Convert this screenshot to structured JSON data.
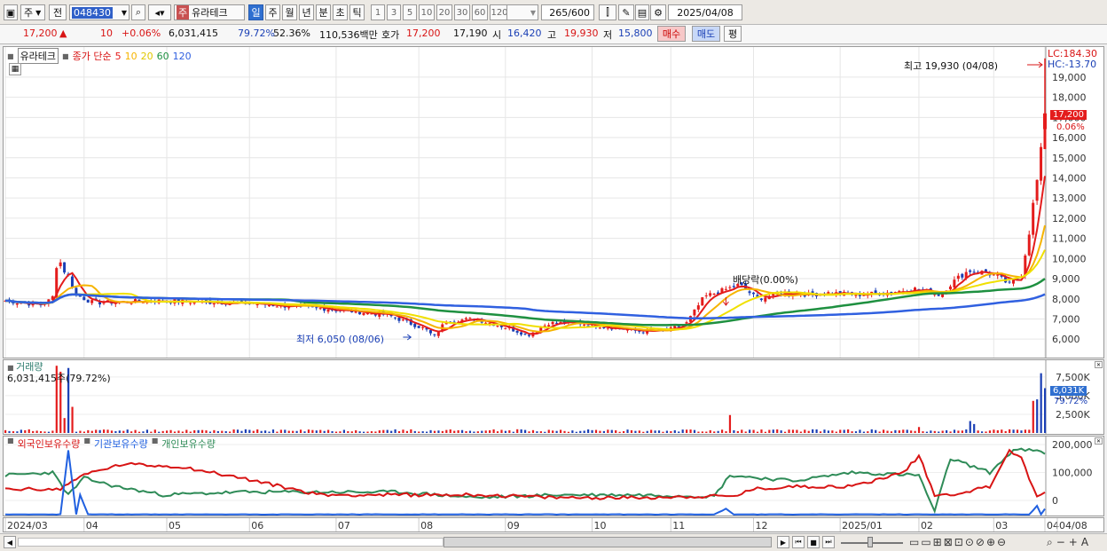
{
  "toolbar": {
    "market": "주",
    "prev": "전",
    "code": "048430",
    "name_tag": "주",
    "name": "유라테크",
    "periods": [
      "일",
      "주",
      "월",
      "년",
      "분",
      "초",
      "틱"
    ],
    "intervals": [
      "1",
      "3",
      "5",
      "10",
      "20",
      "30",
      "60",
      "120"
    ],
    "count": "265",
    "count_max": "/600",
    "date": "2025/04/08"
  },
  "quote": {
    "price": "17,200",
    "arrow": "▲",
    "change": "10",
    "change_pct": "+0.06%",
    "volume": "6,031,415",
    "vol_ratio": "79.72%",
    "turnover": "52.36%",
    "amount": "110,536백만",
    "ask_label": "호가",
    "ask": "17,200",
    "bid": "17,190",
    "open_label": "시",
    "open": "16,420",
    "high_label": "고",
    "high": "19,930",
    "low_label": "저",
    "low": "15,800",
    "buy": "매수",
    "sell": "매도",
    "eval": "평"
  },
  "price_panel": {
    "name": "유라테크",
    "ma_label": "종가 단순",
    "ma": [
      "5",
      "10",
      "20",
      "60",
      "120"
    ],
    "ma_colors": [
      "#e41c1c",
      "#f6b400",
      "#f0e000",
      "#1e9040",
      "#3060e0"
    ],
    "lc": "LC:184.30",
    "hc": "HC:-13.70",
    "high_note": "최고 19,930 (04/08)",
    "low_note": "최저 6,050 (08/06)",
    "dividend_note": "배당락(0.00%)",
    "current": "17,200",
    "current_pct": "0.06%",
    "yticks": [
      "19,000",
      "18,000",
      "17,000",
      "16,000",
      "15,000",
      "14,000",
      "13,000",
      "12,000",
      "11,000",
      "10,000",
      "9,000",
      "8,000",
      "7,000",
      "6,000"
    ]
  },
  "volume_panel": {
    "title": "거래량",
    "value": "6,031,415주(79.72%)",
    "yticks": [
      "7,500K",
      "5,000K",
      "2,500K"
    ],
    "current": "6,031K",
    "current_pct": "79.72%"
  },
  "holding_panel": {
    "series": [
      "외국인보유수량",
      "기관보유수량",
      "개인보유수량"
    ],
    "colors": [
      "#d81414",
      "#2060e0",
      "#2e8b57"
    ],
    "yticks": [
      "200,000",
      "100,000",
      "0"
    ]
  },
  "xaxis": [
    "2024/03",
    "04",
    "05",
    "06",
    "07",
    "08",
    "09",
    "10",
    "11",
    "12",
    "2025/01",
    "02",
    "03",
    "04",
    "04/08"
  ]
}
